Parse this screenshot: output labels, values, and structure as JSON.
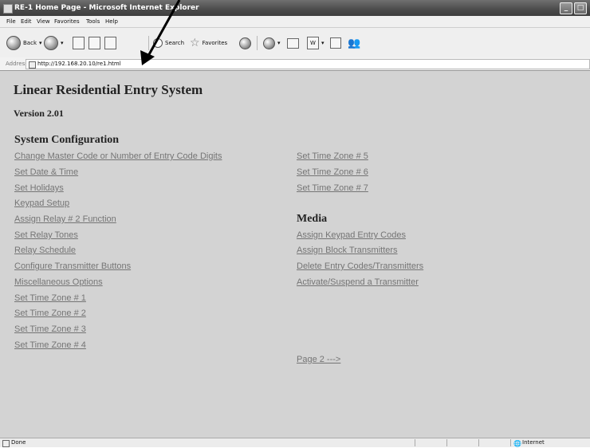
{
  "window": {
    "title": "RE-1 Home Page - Microsoft Internet Explorer",
    "buttons": {
      "minimize": "_",
      "maximize": "□"
    }
  },
  "menubar": [
    "File",
    "Edit",
    "View",
    "Favorites",
    "Tools",
    "Help"
  ],
  "toolbar": {
    "back_label": "Back",
    "search_label": "Search",
    "favorites_label": "Favorites"
  },
  "address": {
    "label": "Address",
    "url": "http://192.168.20.10/re1.html"
  },
  "page": {
    "title": "Linear Residential Entry System",
    "version": "Version 2.01",
    "system_config": {
      "heading": "System Configuration",
      "links": [
        "Change Master Code or Number of Entry Code Digits",
        "Set Date & Time",
        "Set Holidays",
        "Keypad Setup",
        "Assign Relay # 2 Function",
        "Set Relay Tones",
        "Relay Schedule",
        "Configure Transmitter Buttons",
        "Miscellaneous Options",
        "Set Time Zone # 1",
        "Set Time Zone # 2",
        "Set Time Zone # 3",
        "Set Time Zone # 4"
      ],
      "links_right": [
        "Set Time Zone # 5",
        "Set Time Zone # 6",
        "Set Time Zone # 7"
      ]
    },
    "media": {
      "heading": "Media",
      "links": [
        "Assign Keypad Entry Codes",
        "Assign Block Transmitters",
        "Delete Entry Codes/Transmitters",
        "Activate/Suspend a Transmitter"
      ]
    },
    "next_page_link": "Page 2 --->"
  },
  "statusbar": {
    "left": "Done",
    "right": "Internet"
  }
}
